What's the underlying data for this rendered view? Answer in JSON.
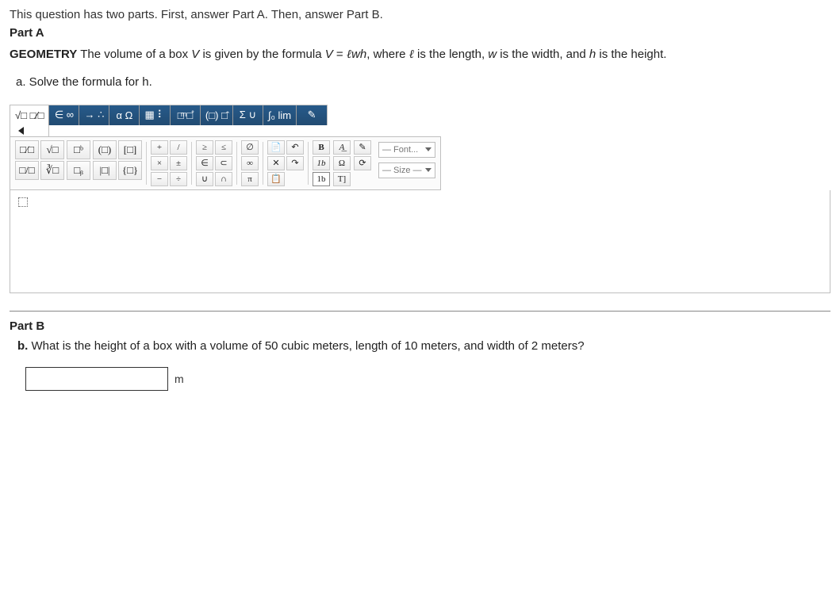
{
  "intro": "This question has two parts. First, answer Part A. Then, answer Part B.",
  "partA": {
    "label": "Part A",
    "topic": "GEOMETRY",
    "text1": " The volume of a box ",
    "varV": "V",
    "text2": " is given by the formula ",
    "eq_left": "V",
    "eq_eq": " = ",
    "eq_right1": "ℓ",
    "eq_right2": "wh",
    "text3": ", where ",
    "varL": "ℓ",
    "text4": " is the length, ",
    "varW": "w",
    "text5": " is the width, and ",
    "varH": "h",
    "text6": " is the height.",
    "subLabel": "a.",
    "subText1": " Solve the formula for ",
    "subVar": "h",
    "subText2": "."
  },
  "tabs": {
    "t1": "√□ □⁄□",
    "t2": "∈ ∞",
    "t3": "→ ∴",
    "t4": "α Ω",
    "t5": "▦ ⠇",
    "t6": "□ͫ □̊",
    "t7": "(□) □̂",
    "t8": "Σ ∪",
    "t9": "∫₀ lim",
    "t10": "✎"
  },
  "toolbar": {
    "g1": {
      "a": "□⁄□",
      "b": "√□",
      "c": "□/□",
      "d": "∛□"
    },
    "g2": {
      "a": "□ᵇ",
      "b": "□ᵦ"
    },
    "g3": {
      "a": "(□)",
      "b": "|□|",
      "c": "[□]",
      "d": "{□}"
    },
    "g4": {
      "a": "+",
      "b": "×",
      "c": "−",
      "d": "/",
      "e": "±",
      "f": "÷"
    },
    "g5": {
      "a": "≥",
      "b": "∈",
      "c": "∪",
      "d": "≤",
      "e": "⊂",
      "f": "∩"
    },
    "g6": {
      "a": "∅",
      "b": "∞",
      "c": "π"
    },
    "g7": {
      "a": "📄",
      "b": "✕",
      "c": "📋",
      "d": "↶",
      "e": "↷"
    },
    "g8": {
      "a": "B",
      "b": "1b",
      "c": "1b",
      "d": "A͟",
      "e": "Ω",
      "f": "T]"
    },
    "g9": {
      "a": "✎",
      "b": "⟳",
      "c": "⁋"
    },
    "font": "— Font...",
    "size": "— Size —"
  },
  "editor": {
    "placeholder": "□"
  },
  "partB": {
    "label": "Part B",
    "subLabel": "b.",
    "text": " What is the height of a box with a volume of 50 cubic meters, length of 10 meters, and width of 2 meters?",
    "unit": "m",
    "value": ""
  }
}
